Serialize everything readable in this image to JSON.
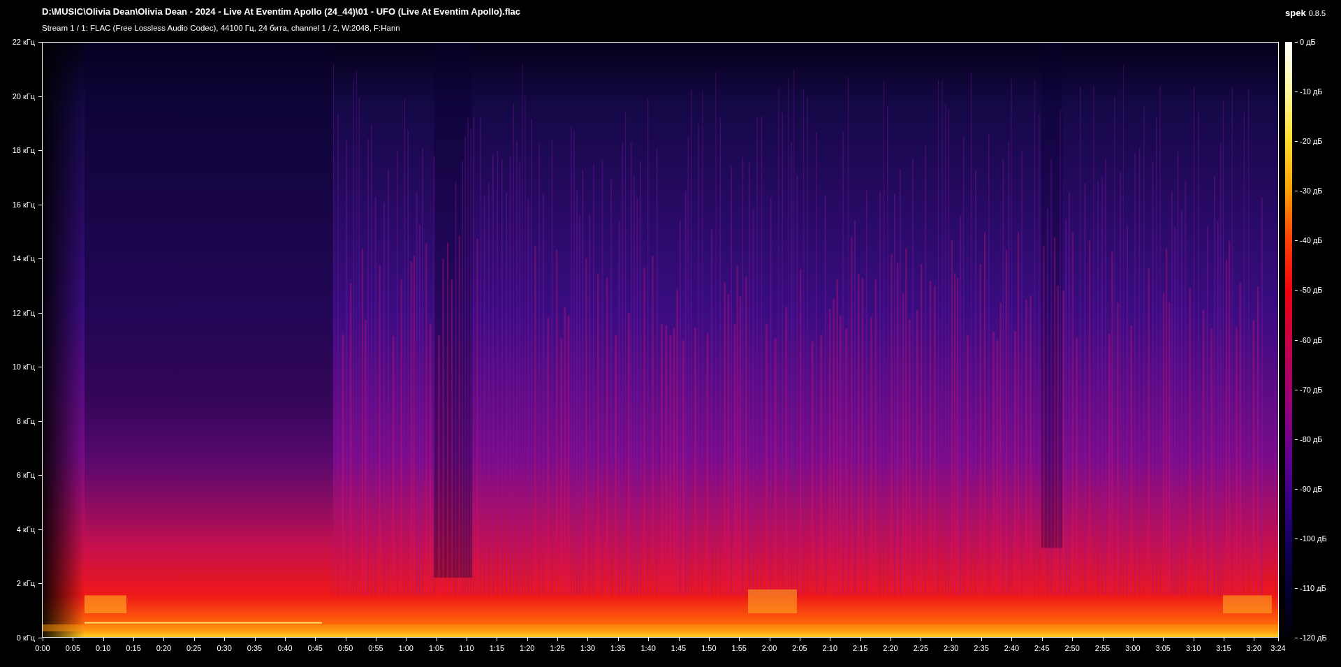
{
  "window": {
    "title": "D:\\MUSIC\\Olivia Dean\\Olivia Dean - 2024 - Live At Eventim Apollo (24_44)\\01 - UFO (Live At Eventim Apollo).flac",
    "subtitle": "Stream 1 / 1: FLAC (Free Lossless Audio Codec), 44100 Гц, 24 бита, channel 1 / 2, W:2048, F:Hann"
  },
  "app": {
    "name": "spek",
    "version": "0.8.5"
  },
  "frequency_axis": [
    "22 кГц",
    "20 кГц",
    "18 кГц",
    "16 кГц",
    "14 кГц",
    "12 кГц",
    "10 кГц",
    "8 кГц",
    "6 кГц",
    "4 кГц",
    "2 кГц",
    "0 кГц"
  ],
  "time_axis": [
    "0:00",
    "0:05",
    "0:10",
    "0:15",
    "0:20",
    "0:25",
    "0:30",
    "0:35",
    "0:40",
    "0:45",
    "0:50",
    "0:55",
    "1:00",
    "1:05",
    "1:10",
    "1:15",
    "1:20",
    "1:25",
    "1:30",
    "1:35",
    "1:40",
    "1:45",
    "1:50",
    "1:55",
    "2:00",
    "2:05",
    "2:10",
    "2:15",
    "2:20",
    "2:25",
    "2:30",
    "2:35",
    "2:40",
    "2:45",
    "2:50",
    "2:55",
    "3:00",
    "3:05",
    "3:10",
    "3:15",
    "3:20",
    "3:24"
  ],
  "level_scale": [
    "0 дБ",
    "-10 дБ",
    "-20 дБ",
    "-30 дБ",
    "-40 дБ",
    "-50 дБ",
    "-60 дБ",
    "-70 дБ",
    "-80 дБ",
    "-90 дБ",
    "-100 дБ",
    "-110 дБ",
    "-120 дБ"
  ]
}
